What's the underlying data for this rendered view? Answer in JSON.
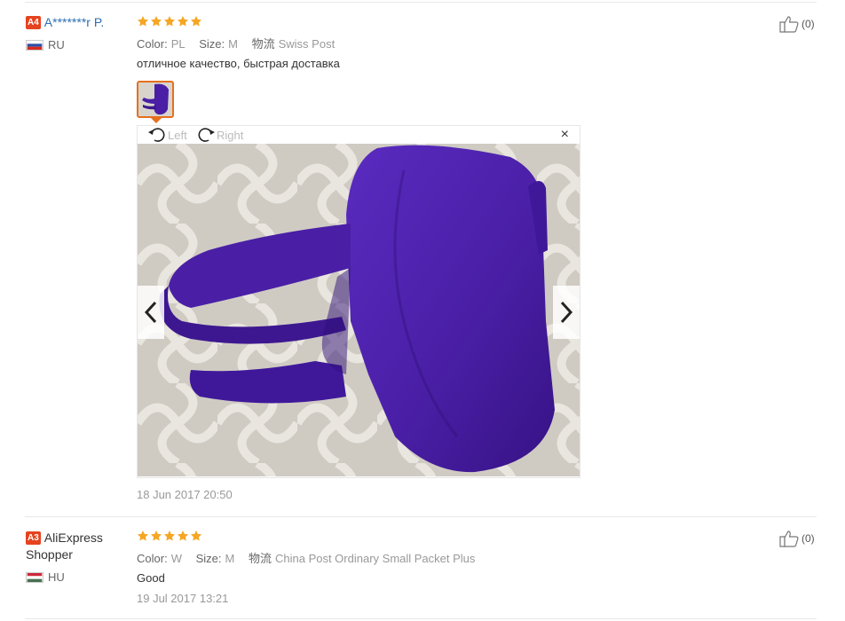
{
  "colors": {
    "star": "#f5a623",
    "badge": "#e5431f",
    "link": "#2d6fb4",
    "garment": "#4a1fa6"
  },
  "viewer": {
    "rotate_left_label": "Left",
    "rotate_right_label": "Right",
    "close_icon": "×"
  },
  "reviews": [
    {
      "level": "A4",
      "name": "A*******r P.",
      "country": "RU",
      "rating": 5,
      "attrs": {
        "color_label": "Color:",
        "color_value": "PL",
        "size_label": "Size:",
        "size_value": "M",
        "logistics_label": "物流",
        "logistics_value": "Swiss Post"
      },
      "feedback": "отличное качество, быстрая доставка",
      "date": "18 Jun 2017 20:50",
      "helpful": "(0)"
    },
    {
      "level": "A3",
      "name": "AliExpress Shopper",
      "country": "HU",
      "rating": 5,
      "attrs": {
        "color_label": "Color:",
        "color_value": "W",
        "size_label": "Size:",
        "size_value": "M",
        "logistics_label": "物流",
        "logistics_value": "China Post Ordinary Small Packet Plus"
      },
      "feedback": "Good",
      "date": "19 Jul 2017 13:21",
      "helpful": "(0)"
    }
  ]
}
